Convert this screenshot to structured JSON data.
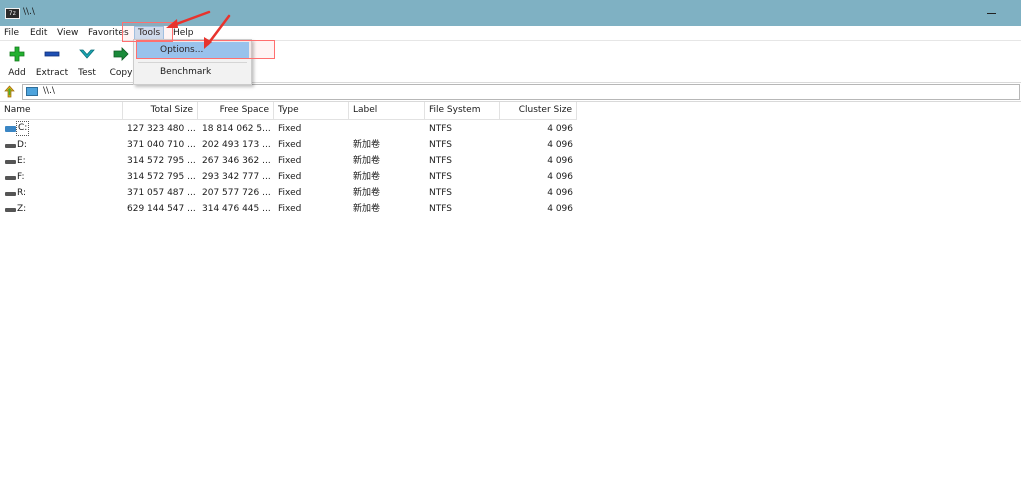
{
  "window": {
    "title": "\\\\.\\",
    "app_icon": "7z"
  },
  "menu": {
    "items": [
      {
        "label": "File"
      },
      {
        "label": "Edit"
      },
      {
        "label": "View"
      },
      {
        "label": "Favorites"
      },
      {
        "label": "Tools"
      },
      {
        "label": "Help"
      }
    ],
    "open_menu": "Tools",
    "tools_dropdown": [
      {
        "label": "Options..."
      },
      {
        "label": "Benchmark"
      }
    ]
  },
  "toolbar": {
    "buttons": [
      {
        "label": "Add",
        "icon": "add-icon",
        "color": "#1faa2a"
      },
      {
        "label": "Extract",
        "icon": "extract-icon",
        "color": "#1e4fb4"
      },
      {
        "label": "Test",
        "icon": "test-icon",
        "color": "#1aa6b4"
      },
      {
        "label": "Copy",
        "icon": "copy-icon",
        "color": "#1a8a3a"
      }
    ]
  },
  "address": {
    "path": "\\\\.\\"
  },
  "columns": [
    "Name",
    "Total Size",
    "Free Space",
    "Type",
    "Label",
    "File System",
    "Cluster Size"
  ],
  "rows": [
    {
      "name": "C:",
      "total": "127 323 480 ...",
      "free": "18 814 062 5...",
      "type": "Fixed",
      "label": "",
      "fs": "NTFS",
      "cluster": "4 096"
    },
    {
      "name": "D:",
      "total": "371 040 710 ...",
      "free": "202 493 173 ...",
      "type": "Fixed",
      "label": "新加卷",
      "fs": "NTFS",
      "cluster": "4 096"
    },
    {
      "name": "E:",
      "total": "314 572 795 ...",
      "free": "267 346 362 ...",
      "type": "Fixed",
      "label": "新加卷",
      "fs": "NTFS",
      "cluster": "4 096"
    },
    {
      "name": "F:",
      "total": "314 572 795 ...",
      "free": "293 342 777 ...",
      "type": "Fixed",
      "label": "新加卷",
      "fs": "NTFS",
      "cluster": "4 096"
    },
    {
      "name": "R:",
      "total": "371 057 487 ...",
      "free": "207 577 726 ...",
      "type": "Fixed",
      "label": "新加卷",
      "fs": "NTFS",
      "cluster": "4 096"
    },
    {
      "name": "Z:",
      "total": "629 144 547 ...",
      "free": "314 476 445 ...",
      "type": "Fixed",
      "label": "新加卷",
      "fs": "NTFS",
      "cluster": "4 096"
    }
  ],
  "colors": {
    "titlebar": "#7fb1c3",
    "menu_highlight": "#91c9f7",
    "annotation": "#e8332d"
  }
}
